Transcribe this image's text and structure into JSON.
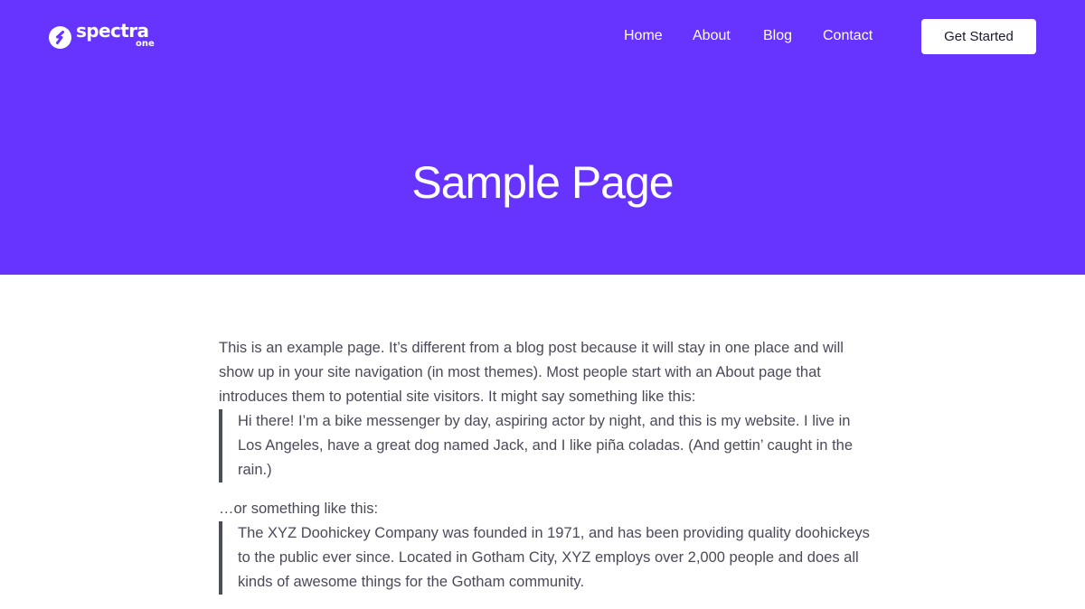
{
  "header": {
    "logo": {
      "word": "spectra",
      "sub": "one",
      "icon": "spectra-logo-icon"
    },
    "nav": [
      {
        "label": "Home"
      },
      {
        "label": "About"
      },
      {
        "label": "Blog"
      },
      {
        "label": "Contact"
      }
    ],
    "cta_label": "Get Started"
  },
  "hero": {
    "title": "Sample Page"
  },
  "content": {
    "intro": "This is an example page. It’s different from a blog post because it will stay in one place and will show up in your site navigation (in most themes). Most people start with an About page that introduces them to potential site visitors. It might say something like this:",
    "quote1": "Hi there! I’m a bike messenger by day, aspiring actor by night, and this is my website. I live in Los Angeles, have a great dog named Jack, and I like piña coladas. (And gettin’ caught in the rain.)",
    "transition": "…or something like this:",
    "quote2": "The XYZ Doohickey Company was founded in 1971, and has been providing quality doohickeys to the public ever since. Located in Gotham City, XYZ employs over 2,000 people and does all kinds of awesome things for the Gotham community."
  },
  "colors": {
    "brand": "#6633ff",
    "text": "#4a4a5a",
    "quote_border": "#4b4f5c"
  }
}
